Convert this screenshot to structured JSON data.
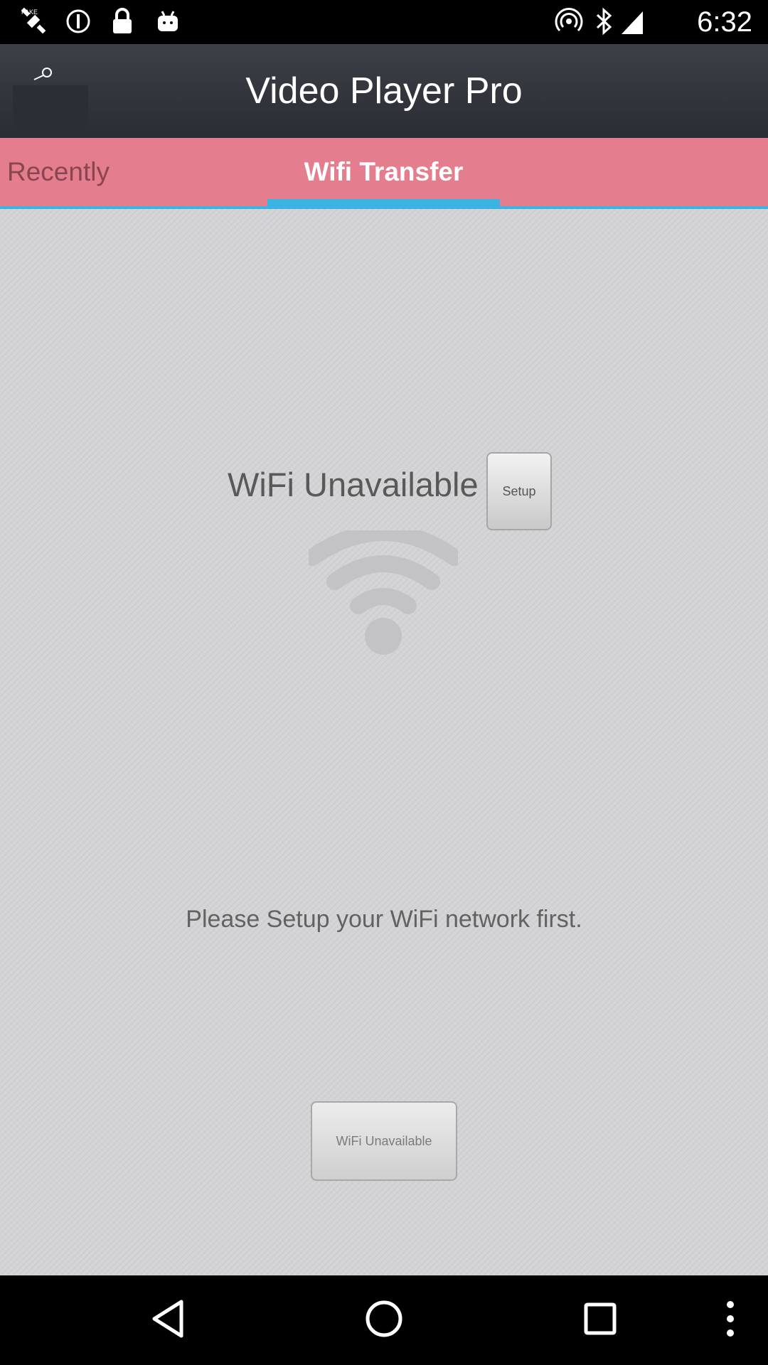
{
  "status_bar": {
    "time": "6:32",
    "left_icons": [
      "fake-gps-icon",
      "data-saver-icon",
      "lock-icon",
      "android-icon"
    ],
    "right_icons": [
      "hotspot-icon",
      "bluetooth-icon",
      "signal-icon"
    ]
  },
  "app_bar": {
    "title": "Video Player Pro",
    "left_icon": "search-icon"
  },
  "tabs": [
    {
      "label": "Recently",
      "selected": false
    },
    {
      "label": "Wifi Transfer",
      "selected": true
    }
  ],
  "wifi_panel": {
    "status_text": "WiFi Unavailable",
    "setup_button": "Setup",
    "wifi_icon": "wifi-icon",
    "message": "Please Setup your WiFi network first.",
    "status_button": "WiFi Unavailable"
  },
  "nav_bar": {
    "buttons": [
      "back-icon",
      "home-icon",
      "recents-icon",
      "more-icon"
    ]
  },
  "colors": {
    "app_bar": "#3c4047",
    "tab_bar": "#e47d8d",
    "tab_indicator": "#3bb3e3",
    "content_bg": "#d4d4d6"
  }
}
